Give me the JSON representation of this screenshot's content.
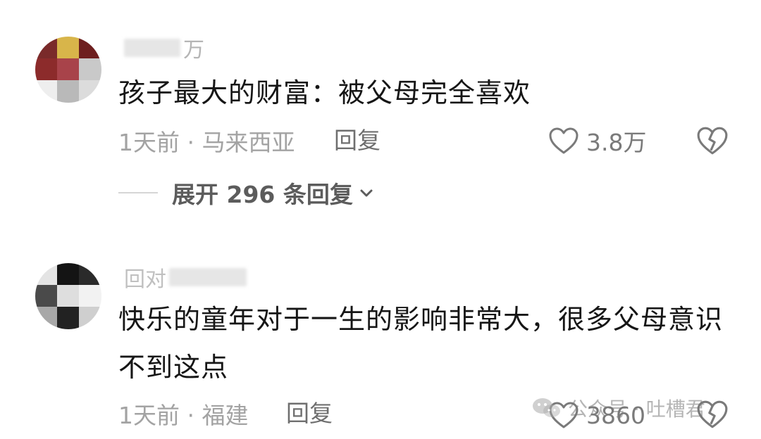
{
  "comments": [
    {
      "username_suffix": "万",
      "text": "孩子最大的财富：被父母完全喜欢",
      "meta": "1天前 · 马来西亚",
      "reply_label": "回复",
      "likes": "3.8万",
      "expand_label": "展开 296 条回复"
    },
    {
      "username_prefix": "回对",
      "text": "快乐的童年对于一生的影响非常大，很多父母意识不到这点",
      "meta": "1天前 · 福建",
      "reply_label": "回复",
      "likes": "3860"
    }
  ],
  "watermark": {
    "text": "公众号 · 吐槽君",
    "icon": "wechat-icon"
  },
  "colors": {
    "text": "#161616",
    "meta": "#a3a3a3",
    "icon": "#7a7a7a"
  }
}
